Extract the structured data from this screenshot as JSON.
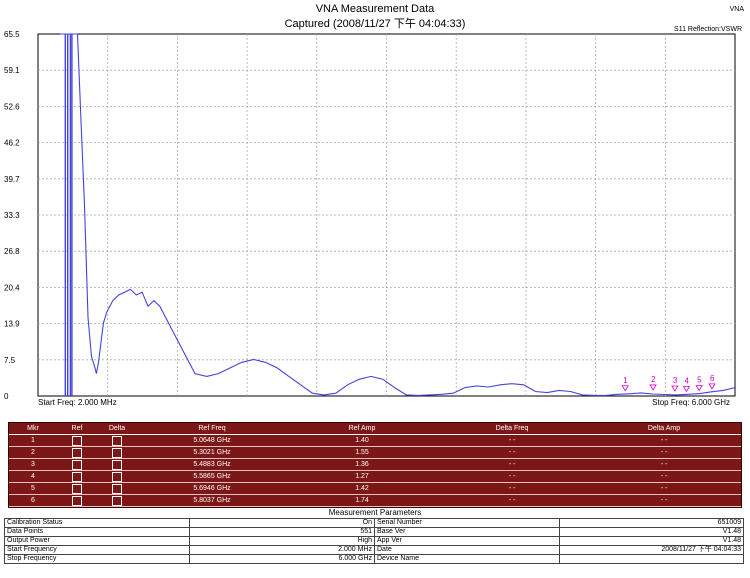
{
  "header": {
    "title": "VNA Measurement Data",
    "subtitle": "Captured  (2008/11/27 下午 04:04:33)",
    "corner_label": "VNA",
    "trace_label": "S11 Reflection:VSWR"
  },
  "chart_data": {
    "type": "line",
    "title": "VNA Measurement Data",
    "xlabel": "",
    "ylabel": "",
    "y_ticks": [
      "65.5",
      "59.1",
      "52.6",
      "46.2",
      "39.7",
      "33.3",
      "26.8",
      "20.4",
      "13.9",
      "7.5",
      "0"
    ],
    "ylim": [
      1.0,
      65.5
    ],
    "xlim_ghz": [
      0.002,
      6.0
    ],
    "grid": true,
    "series": [
      {
        "color": "#4444dd",
        "x_ghz": [
          0.002,
          0.04,
          0.08,
          0.1,
          0.12,
          0.15,
          0.2,
          0.25,
          0.3,
          0.35,
          0.4,
          0.45,
          0.5,
          0.52,
          0.55,
          0.6,
          0.62,
          0.65,
          0.7,
          0.75,
          0.8,
          0.85,
          0.9,
          0.95,
          1.0,
          1.05,
          1.1,
          1.2,
          1.3,
          1.4,
          1.5,
          1.6,
          1.7,
          1.8,
          1.9,
          2.0,
          2.1,
          2.2,
          2.3,
          2.4,
          2.5,
          2.6,
          2.7,
          2.8,
          2.9,
          3.0,
          3.1,
          3.2,
          3.3,
          3.4,
          3.5,
          3.6,
          3.7,
          3.8,
          3.9,
          4.0,
          4.1,
          4.2,
          4.3,
          4.4,
          4.5,
          4.6,
          4.7,
          4.8,
          4.9,
          5.0,
          5.1,
          5.2,
          5.3,
          5.4,
          5.5,
          5.6,
          5.7,
          5.8,
          5.9,
          6.0
        ],
        "y": [
          65.5,
          65.5,
          65.5,
          65.5,
          65.5,
          65.5,
          65.5,
          65.5,
          50,
          35,
          15,
          8,
          6,
          5,
          7,
          12,
          14,
          16,
          18,
          19,
          19.5,
          20,
          19,
          19.5,
          17,
          18,
          17,
          13,
          9,
          5,
          4.5,
          5,
          6,
          7,
          7.5,
          7,
          6,
          4.5,
          3,
          1.5,
          1.2,
          1.5,
          3,
          4,
          4.5,
          4,
          2.5,
          1.2,
          1.1,
          1.2,
          1.3,
          1.5,
          2.5,
          2.8,
          2.6,
          3,
          3.2,
          3,
          1.8,
          1.6,
          2,
          1.8,
          1.2,
          1.1,
          1.1,
          1.3,
          1.4,
          1.55,
          1.36,
          1.27,
          1.2,
          1.3,
          1.42,
          1.74,
          2,
          2.5
        ]
      }
    ],
    "spikes_ghz": [
      0.11,
      0.19,
      0.28,
      0.33
    ],
    "markers": [
      {
        "num": "1",
        "freq_ghz": 5.0648,
        "amp": 1.4
      },
      {
        "num": "2",
        "freq_ghz": 5.3021,
        "amp": 1.55
      },
      {
        "num": "3",
        "freq_ghz": 5.4883,
        "amp": 1.36
      },
      {
        "num": "4",
        "freq_ghz": 5.5865,
        "amp": 1.27
      },
      {
        "num": "5",
        "freq_ghz": 5.6946,
        "amp": 1.42
      },
      {
        "num": "6",
        "freq_ghz": 5.8037,
        "amp": 1.74
      }
    ]
  },
  "axis": {
    "start": "Start Freq: 2.000 MHz",
    "stop": "Stop Freq: 6.000 GHz"
  },
  "marker_table": {
    "headers": [
      "Mkr",
      "Ref",
      "Delta",
      "Ref Freq",
      "Ref Amp",
      "Delta Freq",
      "Delta Amp"
    ],
    "rows": [
      {
        "mkr": "1",
        "freq": "5.0648 GHz",
        "amp": "1.40",
        "dfreq": "- -",
        "damp": "- -"
      },
      {
        "mkr": "2",
        "freq": "5.3021 GHz",
        "amp": "1.55",
        "dfreq": "- -",
        "damp": "- -"
      },
      {
        "mkr": "3",
        "freq": "5.4883 GHz",
        "amp": "1.36",
        "dfreq": "- -",
        "damp": "- -"
      },
      {
        "mkr": "4",
        "freq": "5.5865 GHz",
        "amp": "1.27",
        "dfreq": "- -",
        "damp": "- -"
      },
      {
        "mkr": "5",
        "freq": "5.6946 GHz",
        "amp": "1.42",
        "dfreq": "- -",
        "damp": "- -"
      },
      {
        "mkr": "6",
        "freq": "5.8037 GHz",
        "amp": "1.74",
        "dfreq": "- -",
        "damp": "- -"
      }
    ]
  },
  "params": {
    "title": "Measurement Parameters",
    "left": [
      {
        "label": "Calibration Status",
        "value": "On"
      },
      {
        "label": "Data Points",
        "value": "551"
      },
      {
        "label": "Output Power",
        "value": "High"
      },
      {
        "label": "Start Frequency",
        "value": "2.000 MHz"
      },
      {
        "label": "Stop Frequency",
        "value": "6.000 GHz"
      }
    ],
    "right": [
      {
        "label": "Serial Number",
        "value": "651009"
      },
      {
        "label": "Base Ver",
        "value": "V1.48"
      },
      {
        "label": "App Ver",
        "value": "V1.48"
      },
      {
        "label": "Date",
        "value": "2008/11/27 下午 04:04:33"
      },
      {
        "label": "Device Name",
        "value": ""
      }
    ]
  }
}
